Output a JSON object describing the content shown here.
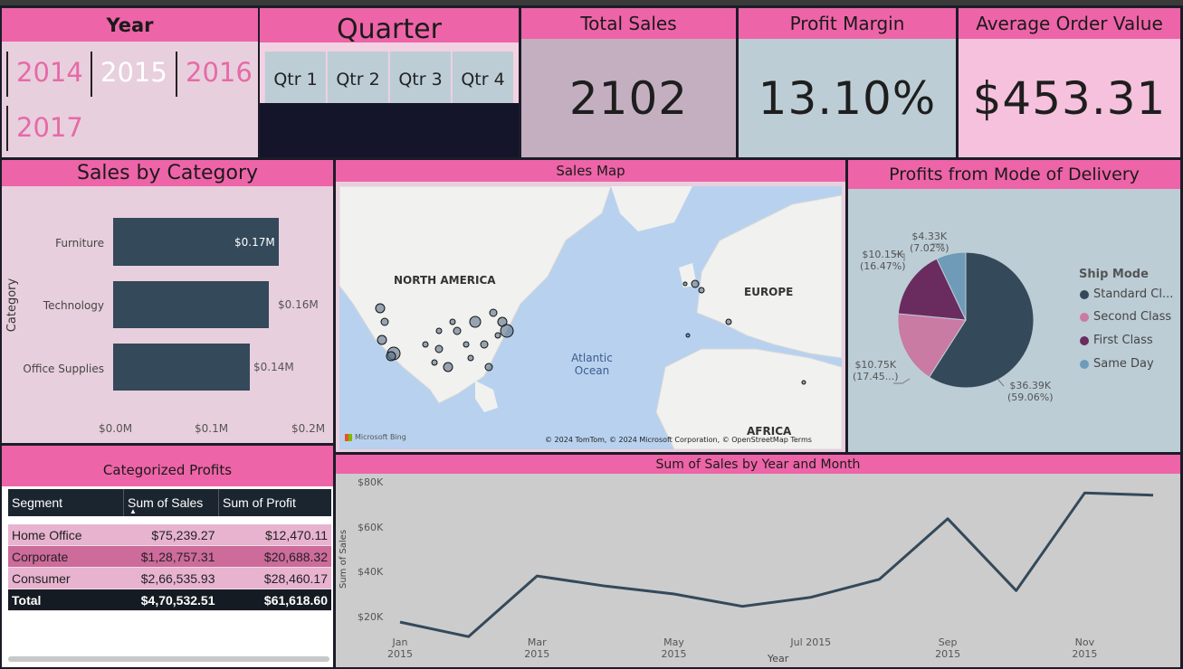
{
  "year_slicer": {
    "title": "Year",
    "years": [
      "2014",
      "2015",
      "2016",
      "2017"
    ],
    "selected": "2015"
  },
  "quarter_slicer": {
    "title": "Quarter",
    "quarters": [
      "Qtr 1",
      "Qtr 2",
      "Qtr 3",
      "Qtr 4"
    ]
  },
  "kpis": {
    "total_sales": {
      "title": "Total Sales",
      "value": "2102"
    },
    "profit_margin": {
      "title": "Profit Margin",
      "value": "13.10%"
    },
    "avg_order": {
      "title": "Average Order Value",
      "value": "$453.31"
    }
  },
  "sales_by_category": {
    "title": "Sales by Category",
    "ylabel": "Category",
    "ticks": [
      "$0.0M",
      "$0.1M",
      "$0.2M"
    ],
    "chart_data": {
      "type": "bar",
      "categories": [
        "Furniture",
        "Technology",
        "Office Supplies"
      ],
      "values": [
        0.17,
        0.16,
        0.14
      ],
      "labels": [
        "$0.17M",
        "$0.16M",
        "$0.14M"
      ],
      "xlim": [
        0,
        0.2
      ],
      "ylabel": "Category"
    }
  },
  "sales_map": {
    "title": "Sales Map",
    "labels": {
      "na": "NORTH AMERICA",
      "europe": "EUROPE",
      "ocean": "Atlantic Ocean",
      "africa": "AFRICA"
    },
    "attribution": "© 2024 TomTom, © 2024 Microsoft Corporation, © OpenStreetMap  Terms",
    "provider": "Microsoft Bing"
  },
  "profits_delivery": {
    "title": "Profits from Mode of Delivery",
    "legend_title": "Ship Mode",
    "legend": [
      "Standard Cl...",
      "Second Class",
      "First Class",
      "Same Day"
    ],
    "labels": [
      {
        "value": "$36.39K",
        "pct": "(59.06%)"
      },
      {
        "value": "$10.75K",
        "pct": "(17.45...)"
      },
      {
        "value": "$10.15K",
        "pct": "(16.47%)"
      },
      {
        "value": "$4.33K",
        "pct": "(7.02%)"
      }
    ],
    "colors": [
      "#34495a",
      "#c97ba3",
      "#6a2c5e",
      "#6f9bb8"
    ],
    "chart_data": {
      "type": "pie",
      "categories": [
        "Standard Class",
        "Second Class",
        "First Class",
        "Same Day"
      ],
      "values": [
        36.39,
        10.75,
        10.15,
        4.33
      ]
    }
  },
  "categorized_profits": {
    "title": "Categorized Profits",
    "columns": [
      "Segment",
      "Sum of Sales",
      "Sum of Profit"
    ],
    "rows": [
      [
        "Home Office",
        "$75,239.27",
        "$12,470.11"
      ],
      [
        "Corporate",
        "$1,28,757.31",
        "$20,688.32"
      ],
      [
        "Consumer",
        "$2,66,535.93",
        "$28,460.17"
      ]
    ],
    "total": [
      "Total",
      "$4,70,532.51",
      "$61,618.60"
    ]
  },
  "sales_by_month": {
    "title": "Sum of Sales by Year and Month",
    "xlabel": "Year",
    "ylabel": "Sum of Sales",
    "xticks": [
      "Jan 2015",
      "Mar 2015",
      "May 2015",
      "Jul 2015",
      "Sep 2015",
      "Nov 2015"
    ],
    "yticks": [
      "$80K",
      "$60K",
      "$40K",
      "$20K"
    ],
    "chart_data": {
      "type": "line",
      "x": [
        "Jan 2015",
        "Feb 2015",
        "Mar 2015",
        "Apr 2015",
        "May 2015",
        "Jun 2015",
        "Jul 2015",
        "Aug 2015",
        "Sep 2015",
        "Oct 2015",
        "Nov 2015",
        "Dec 2015"
      ],
      "values": [
        18000,
        11500,
        38500,
        34000,
        30500,
        25000,
        29000,
        37000,
        64000,
        32000,
        75500,
        74500
      ],
      "ylim": [
        14000,
        80000
      ]
    }
  }
}
